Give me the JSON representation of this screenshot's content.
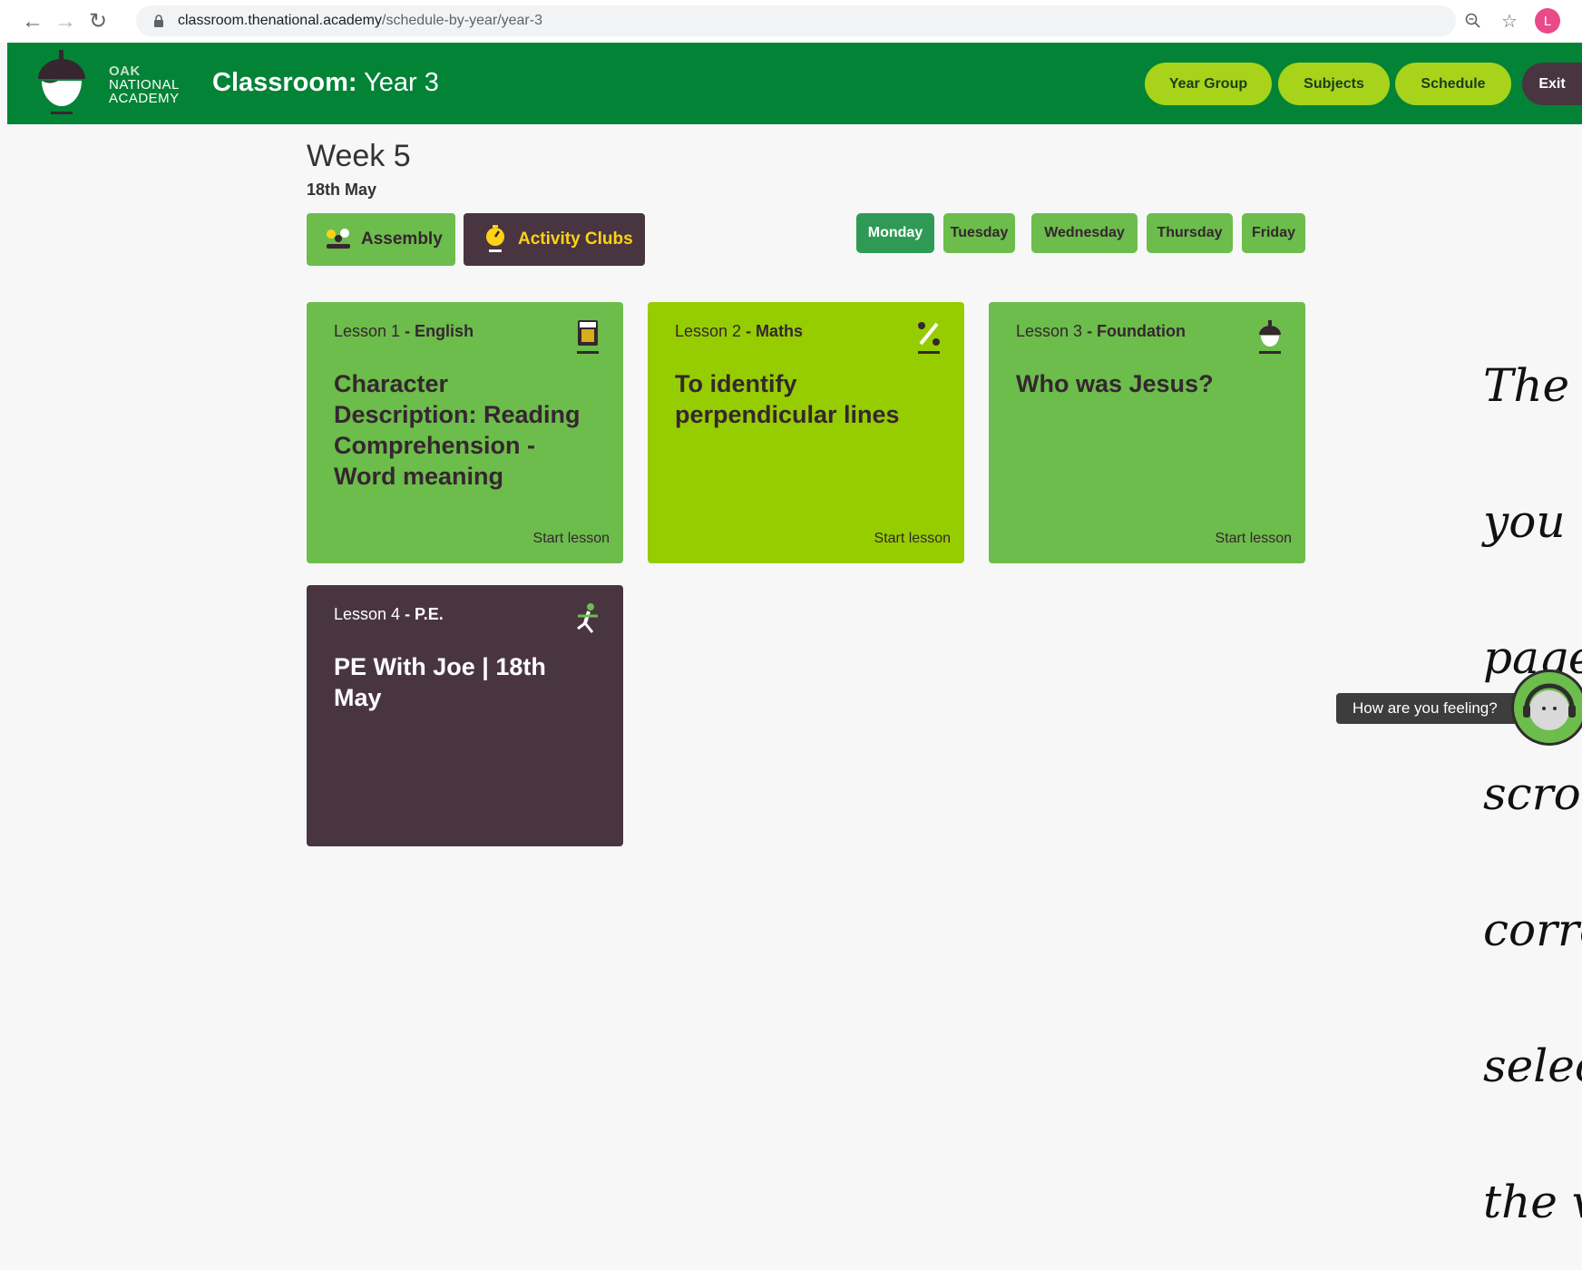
{
  "browser": {
    "url_host": "classroom.thenational.academy",
    "url_path": "/schedule-by-year/year-3",
    "profile_initial": "L"
  },
  "header": {
    "logo_lines": [
      "OAK",
      "NATIONAL",
      "ACADEMY"
    ],
    "title_bold": "Classroom:",
    "title_rest": " Year 3",
    "nav": [
      "Year Group",
      "Subjects",
      "Schedule",
      "Exit"
    ]
  },
  "schedule": {
    "week": "Week 5",
    "date": "18th May",
    "assembly_label": "Assembly",
    "clubs_label": "Activity Clubs",
    "days": [
      "Monday",
      "Tuesday",
      "Wednesday",
      "Thursday",
      "Friday"
    ],
    "active_day": "Monday",
    "lessons": [
      {
        "number": "Lesson 1",
        "subject": " - English",
        "title": "Character Description: Reading Comprehension - Word meaning",
        "action": "Start lesson",
        "icon": "book-icon"
      },
      {
        "number": "Lesson 2",
        "subject": " - Maths",
        "title": "To identify perpendicular lines",
        "action": "Start lesson",
        "icon": "percent-icon"
      },
      {
        "number": "Lesson 3",
        "subject": " - Foundation",
        "title": "Who was Jesus?",
        "action": "Start lesson",
        "icon": "acorn-icon"
      },
      {
        "number": "Lesson 4",
        "subject": " - P.E.",
        "title": "PE With Joe | 18th May",
        "action": "",
        "icon": "runner-icon"
      }
    ]
  },
  "annotation": {
    "lines": [
      "The l",
      "you",
      "page",
      "scrol",
      "corre",
      "selec",
      "the v"
    ]
  },
  "feeling_prompt": "How are you feeling?",
  "colors": {
    "brand_green": "#038336",
    "lime": "#96cd00",
    "card_green": "#6cbd4b",
    "plum": "#493540",
    "yellow": "#ffd215"
  }
}
